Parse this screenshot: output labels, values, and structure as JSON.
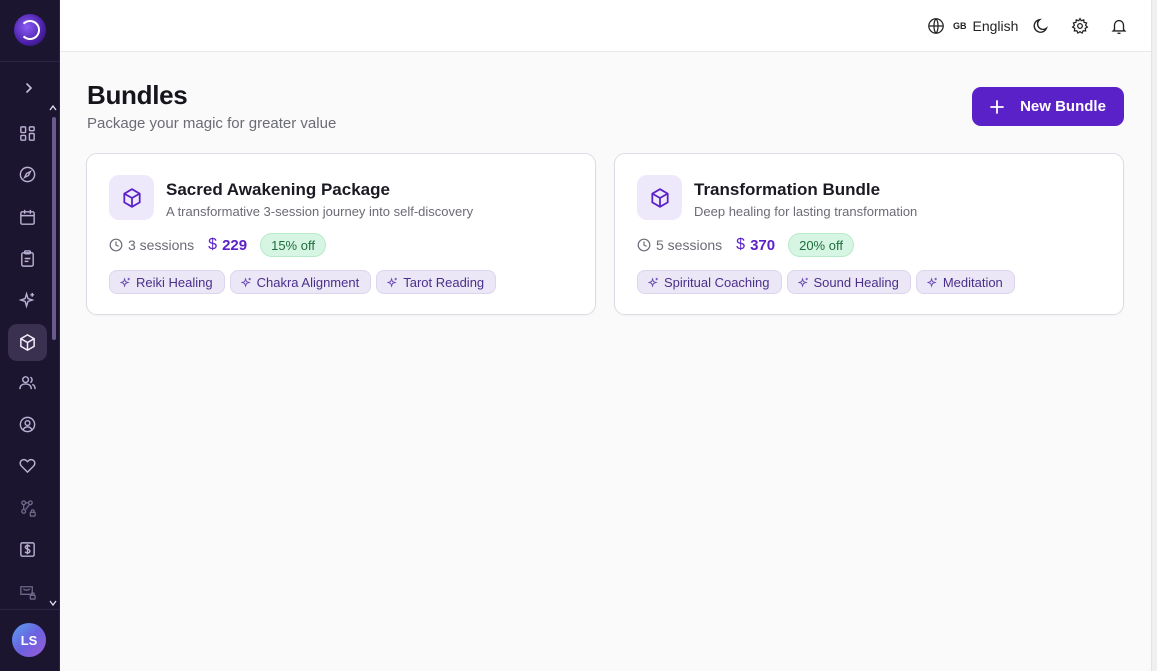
{
  "sidebar": {
    "nav_icons": [
      "dashboard-icon",
      "compass-icon",
      "calendar-icon",
      "clipboard-icon",
      "sparkles-icon",
      "package-icon",
      "users-icon",
      "user-circle-icon",
      "heart-icon",
      "workflow-locked-icon",
      "dollar-file-icon",
      "shopping-bag-locked-icon"
    ],
    "active_item": "package-icon",
    "avatar_initials": "LS"
  },
  "topbar": {
    "language_flag": "GB",
    "language_label": "English"
  },
  "page": {
    "title": "Bundles",
    "subtitle": "Package your magic for greater value",
    "new_button_label": "New Bundle"
  },
  "bundles": [
    {
      "title": "Sacred Awakening Package",
      "description": "A transformative 3-session journey into self-discovery",
      "sessions": "3 sessions",
      "price": "$229",
      "discount": "15% off",
      "tags": [
        "Reiki Healing",
        "Chakra Alignment",
        "Tarot Reading"
      ]
    },
    {
      "title": "Transformation Bundle",
      "description": "Deep healing for lasting transformation",
      "sessions": "5 sessions",
      "price": "$370",
      "discount": "20% off",
      "tags": [
        "Spiritual Coaching",
        "Sound Healing",
        "Meditation"
      ]
    }
  ],
  "colors": {
    "accent": "#5b21c9",
    "sidebar_bg": "#1c1530",
    "discount_bg": "#d6f5e2",
    "tag_bg": "#ece7f6"
  }
}
